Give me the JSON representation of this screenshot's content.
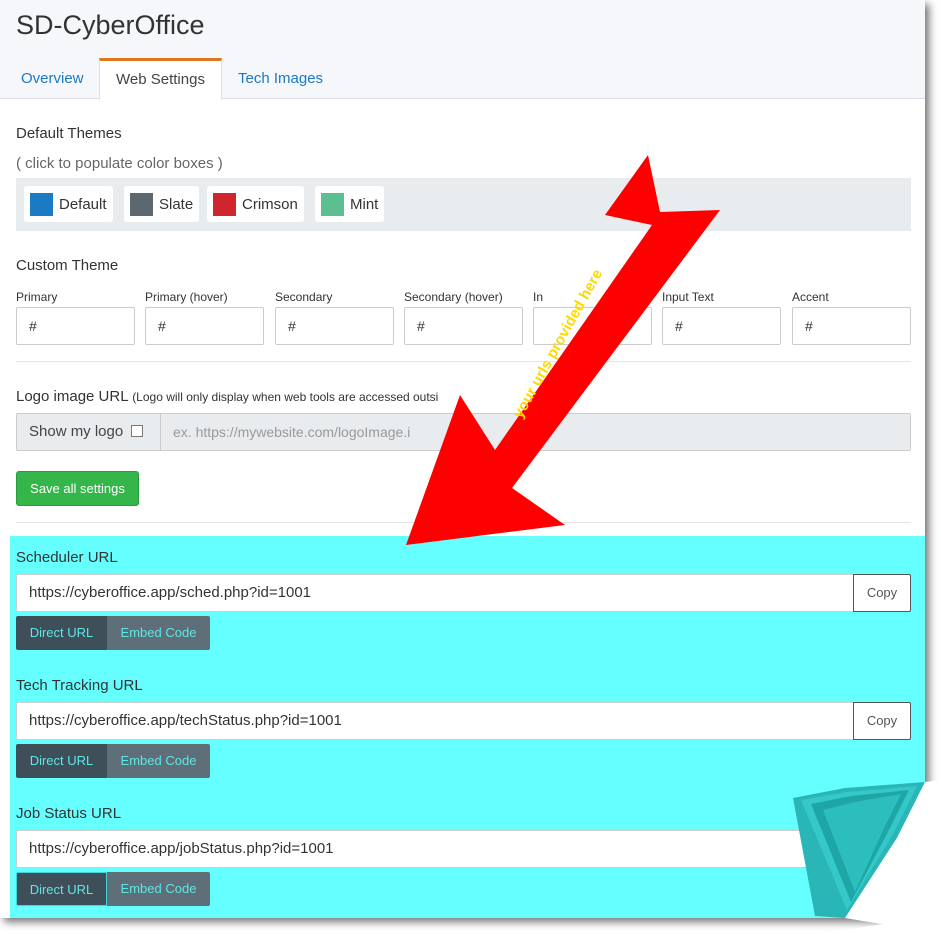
{
  "app": {
    "title": "SD-CyberOffice"
  },
  "tabs": [
    {
      "label": "Overview"
    },
    {
      "label": "Web Settings"
    },
    {
      "label": "Tech Images"
    }
  ],
  "default_themes": {
    "title": "Default Themes",
    "hint": "( click to populate color boxes )",
    "themes": [
      {
        "label": "Default",
        "color": "#1a7ac4"
      },
      {
        "label": "Slate",
        "color": "#5c6770"
      },
      {
        "label": "Crimson",
        "color": "#d0242f"
      },
      {
        "label": "Mint",
        "color": "#5cbf92"
      }
    ]
  },
  "custom_theme": {
    "title": "Custom Theme",
    "fields": [
      {
        "label": "Primary",
        "value": "#"
      },
      {
        "label": "Primary (hover)",
        "value": "#"
      },
      {
        "label": "Secondary",
        "value": "#"
      },
      {
        "label": "Secondary (hover)",
        "value": "#"
      },
      {
        "label": "In",
        "value": ""
      },
      {
        "label": "Input Text",
        "value": "#"
      },
      {
        "label": "Accent",
        "value": "#"
      }
    ]
  },
  "logo": {
    "label": "Logo image URL",
    "note": "(Logo will only display when web tools are accessed outsi",
    "show_label": "Show my logo",
    "placeholder": "ex. https://mywebsite.com/logoImage.i"
  },
  "save_label": "Save all settings",
  "urls": [
    {
      "label": "Scheduler URL",
      "value": "https://cyberoffice.app/sched.php?id=1001",
      "copy": "Copy",
      "direct": "Direct URL",
      "embed": "Embed Code"
    },
    {
      "label": "Tech Tracking URL",
      "value": "https://cyberoffice.app/techStatus.php?id=1001",
      "copy": "Copy",
      "direct": "Direct URL",
      "embed": "Embed Code"
    },
    {
      "label": "Job Status URL",
      "value": "https://cyberoffice.app/jobStatus.php?id=1001",
      "copy": "",
      "direct": "Direct URL",
      "embed": "Embed Code"
    }
  ],
  "annotation": {
    "text": "your urls provided here",
    "arrow_color": "#ff0000",
    "text_color": "#ffd800",
    "highlight_color": "#66ffff"
  }
}
